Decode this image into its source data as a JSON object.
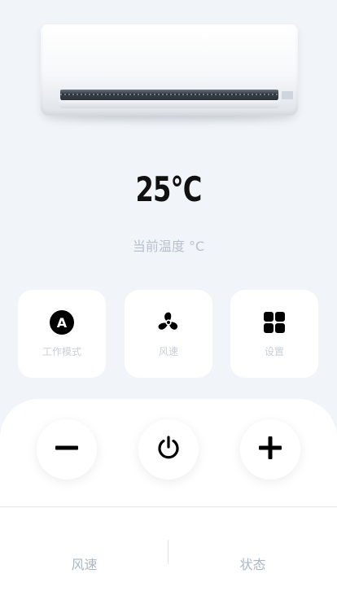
{
  "temperature": {
    "value": "25°C",
    "label": "当前温度 °C"
  },
  "mode_cards": [
    {
      "label": "工作模式",
      "icon": "auto-mode-icon",
      "badge": "A"
    },
    {
      "label": "风速",
      "icon": "fan-icon"
    },
    {
      "label": "设置",
      "icon": "grid-icon"
    }
  ],
  "controls": {
    "minus": {
      "icon": "minus-icon"
    },
    "power": {
      "icon": "power-icon"
    },
    "plus": {
      "icon": "plus-icon"
    }
  },
  "bottom_tabs": [
    {
      "label": "风速"
    },
    {
      "label": "状态"
    }
  ],
  "colors": {
    "background": "#f1f5f9",
    "card": "#ffffff",
    "primary_text": "#111111",
    "muted_text": "#b7c1cc"
  }
}
